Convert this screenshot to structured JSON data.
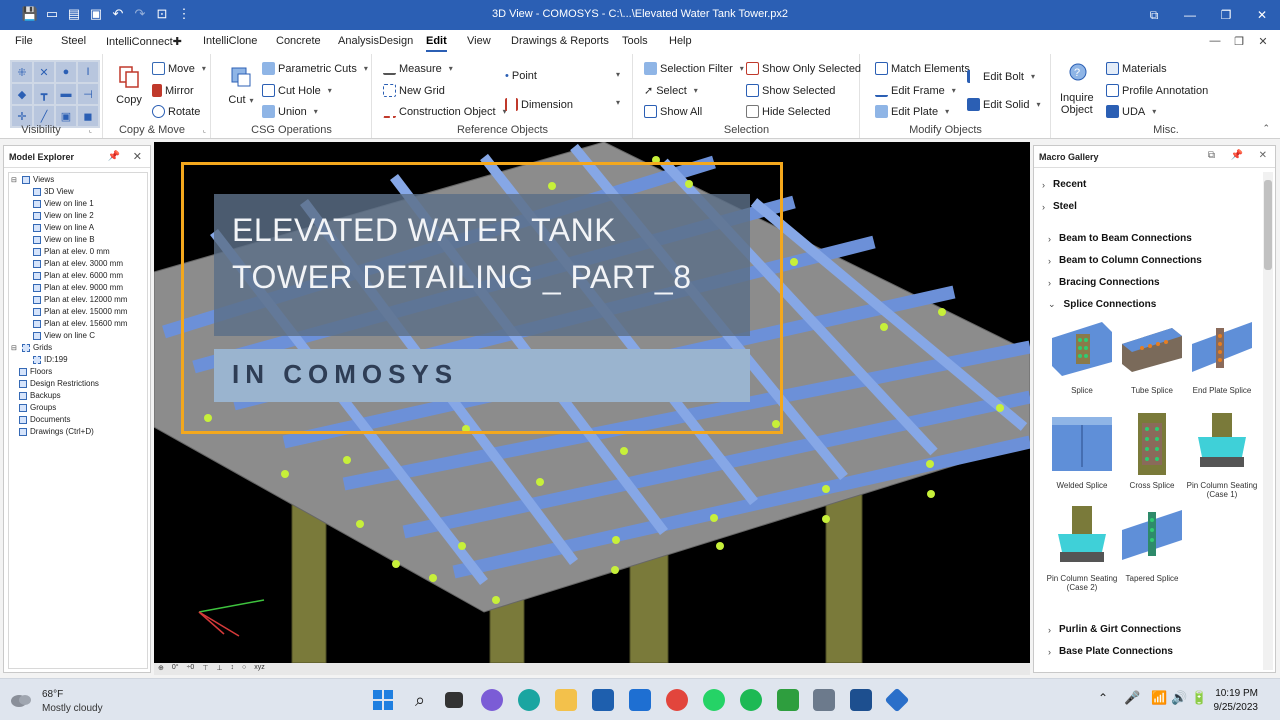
{
  "window": {
    "title": "3D View - COMOSYS - C:\\...\\Elevated Water Tank Tower.px2"
  },
  "menu": {
    "tabs": [
      "File",
      "Steel",
      "IntelliConnect✚",
      "IntelliClone",
      "Concrete",
      "AnalysisDesign",
      "Edit",
      "View",
      "Drawings & Reports",
      "Tools",
      "Help"
    ],
    "active": "Edit"
  },
  "ribbon": {
    "visibility": {
      "label": "Visibility"
    },
    "copymove": {
      "copy": "Copy",
      "move": "Move",
      "mirror": "Mirror",
      "rotate": "Rotate",
      "label": "Copy & Move"
    },
    "csg": {
      "cut": "Cut",
      "parametric_cuts": "Parametric Cuts",
      "cut_hole": "Cut Hole",
      "union": "Union",
      "label": "CSG Operations"
    },
    "reference": {
      "measure": "Measure",
      "new_grid": "New Grid",
      "construction_object": "Construction Object",
      "point": "Point",
      "dimension": "Dimension",
      "label": "Reference Objects"
    },
    "selection": {
      "selection_filter": "Selection Filter",
      "select": "Select",
      "show_all": "Show All",
      "show_only_selected": "Show Only Selected",
      "show_selected": "Show Selected",
      "hide_selected": "Hide Selected",
      "label": "Selection"
    },
    "modify": {
      "match_elements": "Match Elements",
      "edit_frame": "Edit Frame",
      "edit_plate": "Edit Plate",
      "edit_bolt": "Edit Bolt",
      "edit_solid": "Edit Solid",
      "label": "Modify Objects"
    },
    "misc": {
      "inquire": "Inquire",
      "object": "Object",
      "materials": "Materials",
      "profile_annotation": "Profile Annotation",
      "uda": "UDA",
      "label": "Misc."
    }
  },
  "model_explorer": {
    "title": "Model Explorer",
    "views_label": "Views",
    "views": [
      "3D View",
      "View on line 1",
      "View on line 2",
      "View on line A",
      "View on line B",
      "Plan at elev. 0 mm",
      "Plan at elev. 3000 mm",
      "Plan at elev. 6000 mm",
      "Plan at elev. 9000 mm",
      "Plan at elev. 12000 mm",
      "Plan at elev. 15000 mm",
      "Plan at elev. 15600 mm",
      "View on line C"
    ],
    "grids_label": "Grids",
    "grid_id": "ID:199",
    "others": [
      "Floors",
      "Design Restrictions",
      "Backups",
      "Groups",
      "Documents",
      "Drawings (Ctrl+D)"
    ]
  },
  "overlay": {
    "line1": "ELEVATED WATER TANK",
    "line2": "TOWER DETAILING _ PART_8",
    "subtitle": "IN COMOSYS",
    "frame_color": "#f4a81d"
  },
  "viewport_footer": {
    "items": [
      "⊕",
      "0°",
      "÷0",
      "⊤",
      "⊥",
      "↕",
      "○",
      "xyz"
    ]
  },
  "macro_gallery": {
    "title": "Macro Gallery",
    "sections": [
      "Recent",
      "Steel"
    ],
    "categories": [
      "Beam to Beam Connections",
      "Beam to Column Connections",
      "Bracing Connections",
      "Splice Connections"
    ],
    "splice_items": [
      "Splice",
      "Tube Splice",
      "End Plate Splice",
      "Welded Splice",
      "Cross Splice",
      "Pin Column Seating (Case 1)",
      "Pin Column Seating (Case 2)",
      "Tapered Splice"
    ],
    "more_categories": [
      "Purlin & Girt Connections",
      "Base Plate Connections"
    ]
  },
  "taskbar": {
    "temperature": "68°F",
    "weather": "Mostly cloudy",
    "time": "10:19 PM",
    "date": "9/25/2023"
  }
}
